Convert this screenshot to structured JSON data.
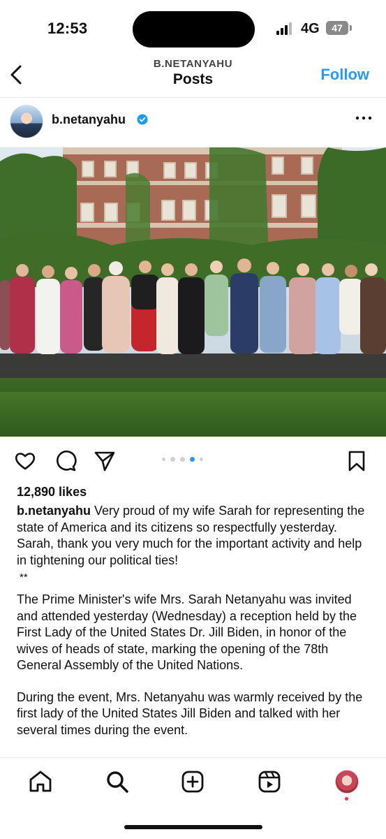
{
  "status_bar": {
    "time": "12:53",
    "network": "4G",
    "battery": "47"
  },
  "header": {
    "username": "B.NETANYAHU",
    "title": "Posts",
    "follow_label": "Follow"
  },
  "post": {
    "author": "b.netanyahu",
    "verified_color": "#1d9bf0",
    "image_alt": "Group photo of women at a reception in front of a brick building",
    "carousel": {
      "count": 5,
      "active": 3
    },
    "likes": "12,890 likes",
    "caption_first": "Very proud of my wife Sarah for representing the state of America and its citizens so respectfully yesterday. Sarah, thank you very much for the important activity and help in tightening our political ties!",
    "caption_separator": "**",
    "caption_para2": "The Prime Minister's wife Mrs. Sarah Netanyahu was invited and attended yesterday (Wednesday) a reception held by the First Lady of the United States Dr. Jill Biden, in honor of the wives of heads of state, marking the opening of the 78th General Assembly of the United Nations.",
    "caption_para3": "During the event, Mrs. Netanyahu was warmly received by the first lady of the United States Jill Biden and talked with her several times during the event."
  },
  "icons": {
    "back": "chevron-left-icon",
    "more": "more-horizontal-icon",
    "like": "heart-icon",
    "comment": "comment-icon",
    "share": "send-icon",
    "save": "bookmark-icon",
    "home": "home-icon",
    "search": "search-icon",
    "create": "plus-square-icon",
    "reels": "reels-icon"
  },
  "accent_color": "#2a9af0"
}
